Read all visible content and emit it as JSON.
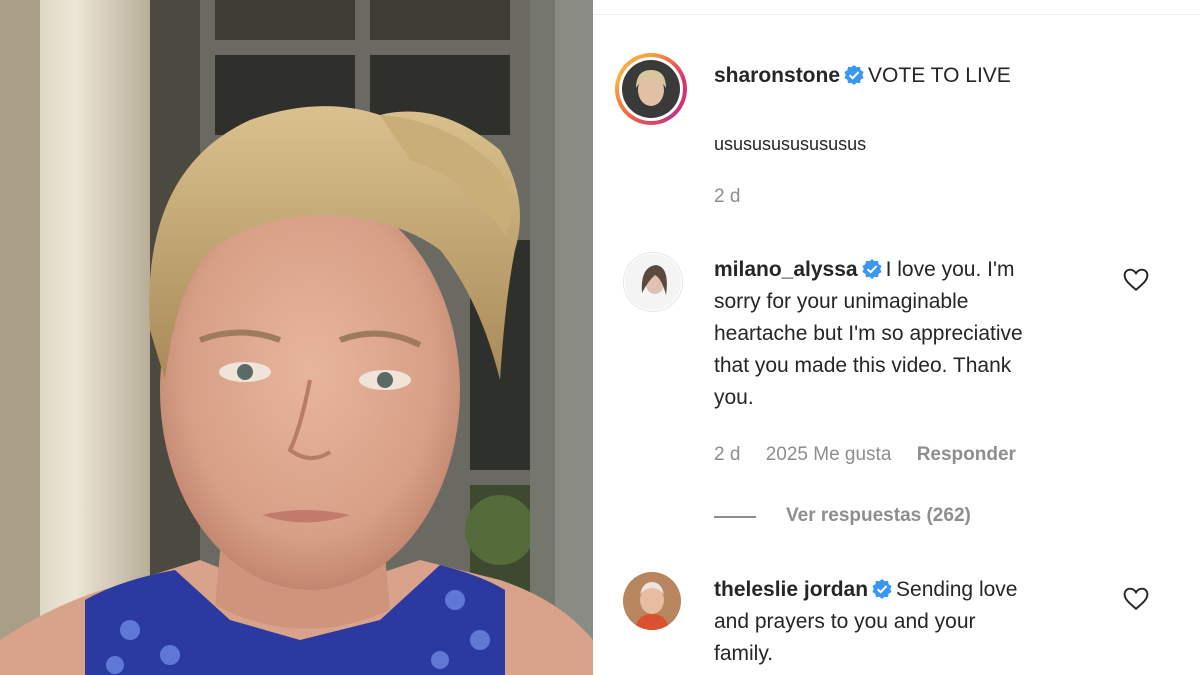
{
  "post": {
    "username": "sharonstone",
    "caption": "VOTE TO LIVE",
    "body": "usususususususus",
    "time": "2 d"
  },
  "comments": [
    {
      "username": "milano_alyssa",
      "text_lines": [
        "I love you. I'm",
        "sorry for your unimaginable",
        "heartache but I'm so appreciative",
        "that you made this video. Thank",
        "you."
      ],
      "time": "2 d",
      "likes": "2025 Me gusta",
      "reply": "Responder",
      "view_replies": "Ver respuestas (262)"
    },
    {
      "username": "theleslie jordan",
      "text_lines": [
        "Sending love",
        "and prayers to you and your",
        "family."
      ]
    }
  ],
  "colors": {
    "verified": "#3897f0",
    "muted_text": "#8e8e8e",
    "text": "#262626"
  },
  "icons": {
    "verified": "verified-badge-icon",
    "like": "heart-outline-icon"
  }
}
